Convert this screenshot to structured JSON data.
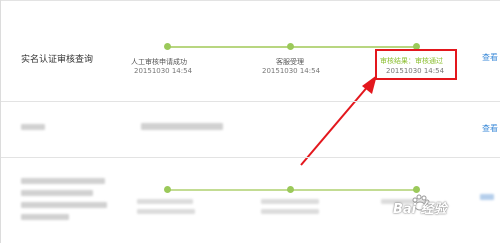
{
  "row1": {
    "title": "实名认证审核查询",
    "steps": [
      {
        "label": "人工审核申请成功",
        "time": "20151030 14:54"
      },
      {
        "label": "客服受理",
        "time": "20151030 14:54"
      },
      {
        "label": "审核结果：审核通过",
        "time": "20151030 14:54"
      }
    ],
    "action": "查看"
  },
  "row2": {
    "action": "查看"
  },
  "watermark": "Bai  经验",
  "colors": {
    "track": "#b8d680",
    "dot": "#9bc95a",
    "accent_green": "#8bbf2f",
    "link_blue": "#3b8ad8",
    "highlight_red": "#e3171d"
  }
}
